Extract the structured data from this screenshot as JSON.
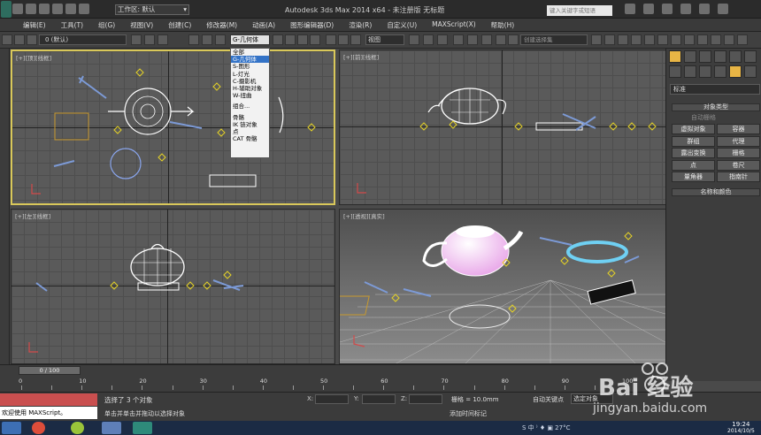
{
  "window": {
    "title": "Autodesk 3ds Max  2014 x64    - 未注册版   无标题",
    "workspace": "工作区: 默认",
    "search_placeholder": "键入关键字或短语"
  },
  "menu": [
    "编辑(E)",
    "工具(T)",
    "组(G)",
    "视图(V)",
    "创建(C)",
    "修改器(M)",
    "动画(A)",
    "图形编辑器(D)",
    "渲染(R)",
    "自定义(U)",
    "MAXScript(X)",
    "帮助(H)"
  ],
  "toolbar": {
    "layer": "0 (默认)",
    "filter": "G-几何体",
    "ref_coord": "视图",
    "selection_set": "创建选择集"
  },
  "filter_dropdown": {
    "items": [
      "全部",
      "G-几何体",
      "S-图形",
      "L-灯光",
      "C-摄影机",
      "H-辅助对象",
      "W-扭曲",
      "组合...",
      "骨骼",
      "IK 链对象",
      "点",
      "CAT 骨骼"
    ],
    "selected": "G-几何体"
  },
  "viewports": {
    "top": "[+][顶][线框]",
    "front": "[+][前][线框]",
    "left": "[+][左][线框]",
    "persp": "[+][透视][真实]"
  },
  "command_panel": {
    "dropdown": "标准",
    "object_type_title": "对象类型",
    "autogrid": "自动栅格",
    "buttons": [
      "虚拟对象",
      "容器",
      "群组",
      "代理",
      "露出变换",
      "栅格",
      "点",
      "卷尺",
      "量角器",
      "指南针"
    ],
    "name_color_title": "名称和颜色"
  },
  "timeline": {
    "slider": "0 / 100",
    "ticks": [
      "0",
      "10",
      "20",
      "30",
      "40",
      "50",
      "60",
      "70",
      "80",
      "90",
      "100"
    ]
  },
  "status": {
    "maxscript": "欢迎使用 MAXScript。",
    "selected": "选择了 3 个对象",
    "hint": "单击并单击并拖动以选择对象",
    "x_label": "X:",
    "y_label": "Y:",
    "z_label": "Z:",
    "grid": "栅格 = 10.0mm",
    "autokey": "自动关键点",
    "setkey": "选定对象",
    "add_time_tag": "添加时间标记"
  },
  "taskbar": {
    "tray": "S 中 ⁾ ♦ ▣ 27°C",
    "time": "19:24",
    "date": "2014/10/5"
  },
  "watermark": {
    "brand": "Bai 经验",
    "url": "jingyan.baidu.com"
  },
  "colors": {
    "active_border": "#d9c85a",
    "selection_blue": "#3373c7",
    "command_tab_active": "#e8b545"
  }
}
